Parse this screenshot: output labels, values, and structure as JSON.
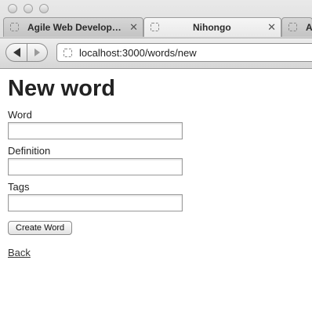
{
  "browser": {
    "tabs": [
      {
        "label": "Agile Web Develop…",
        "active": false
      },
      {
        "label": "Nihongo",
        "active": true
      },
      {
        "label": "A",
        "active": false
      }
    ],
    "url": "localhost:3000/words/new"
  },
  "page": {
    "heading": "New word",
    "fields": [
      {
        "label": "Word",
        "value": ""
      },
      {
        "label": "Definition",
        "value": ""
      },
      {
        "label": "Tags",
        "value": ""
      }
    ],
    "submit_label": "Create Word",
    "back_link": "Back"
  }
}
